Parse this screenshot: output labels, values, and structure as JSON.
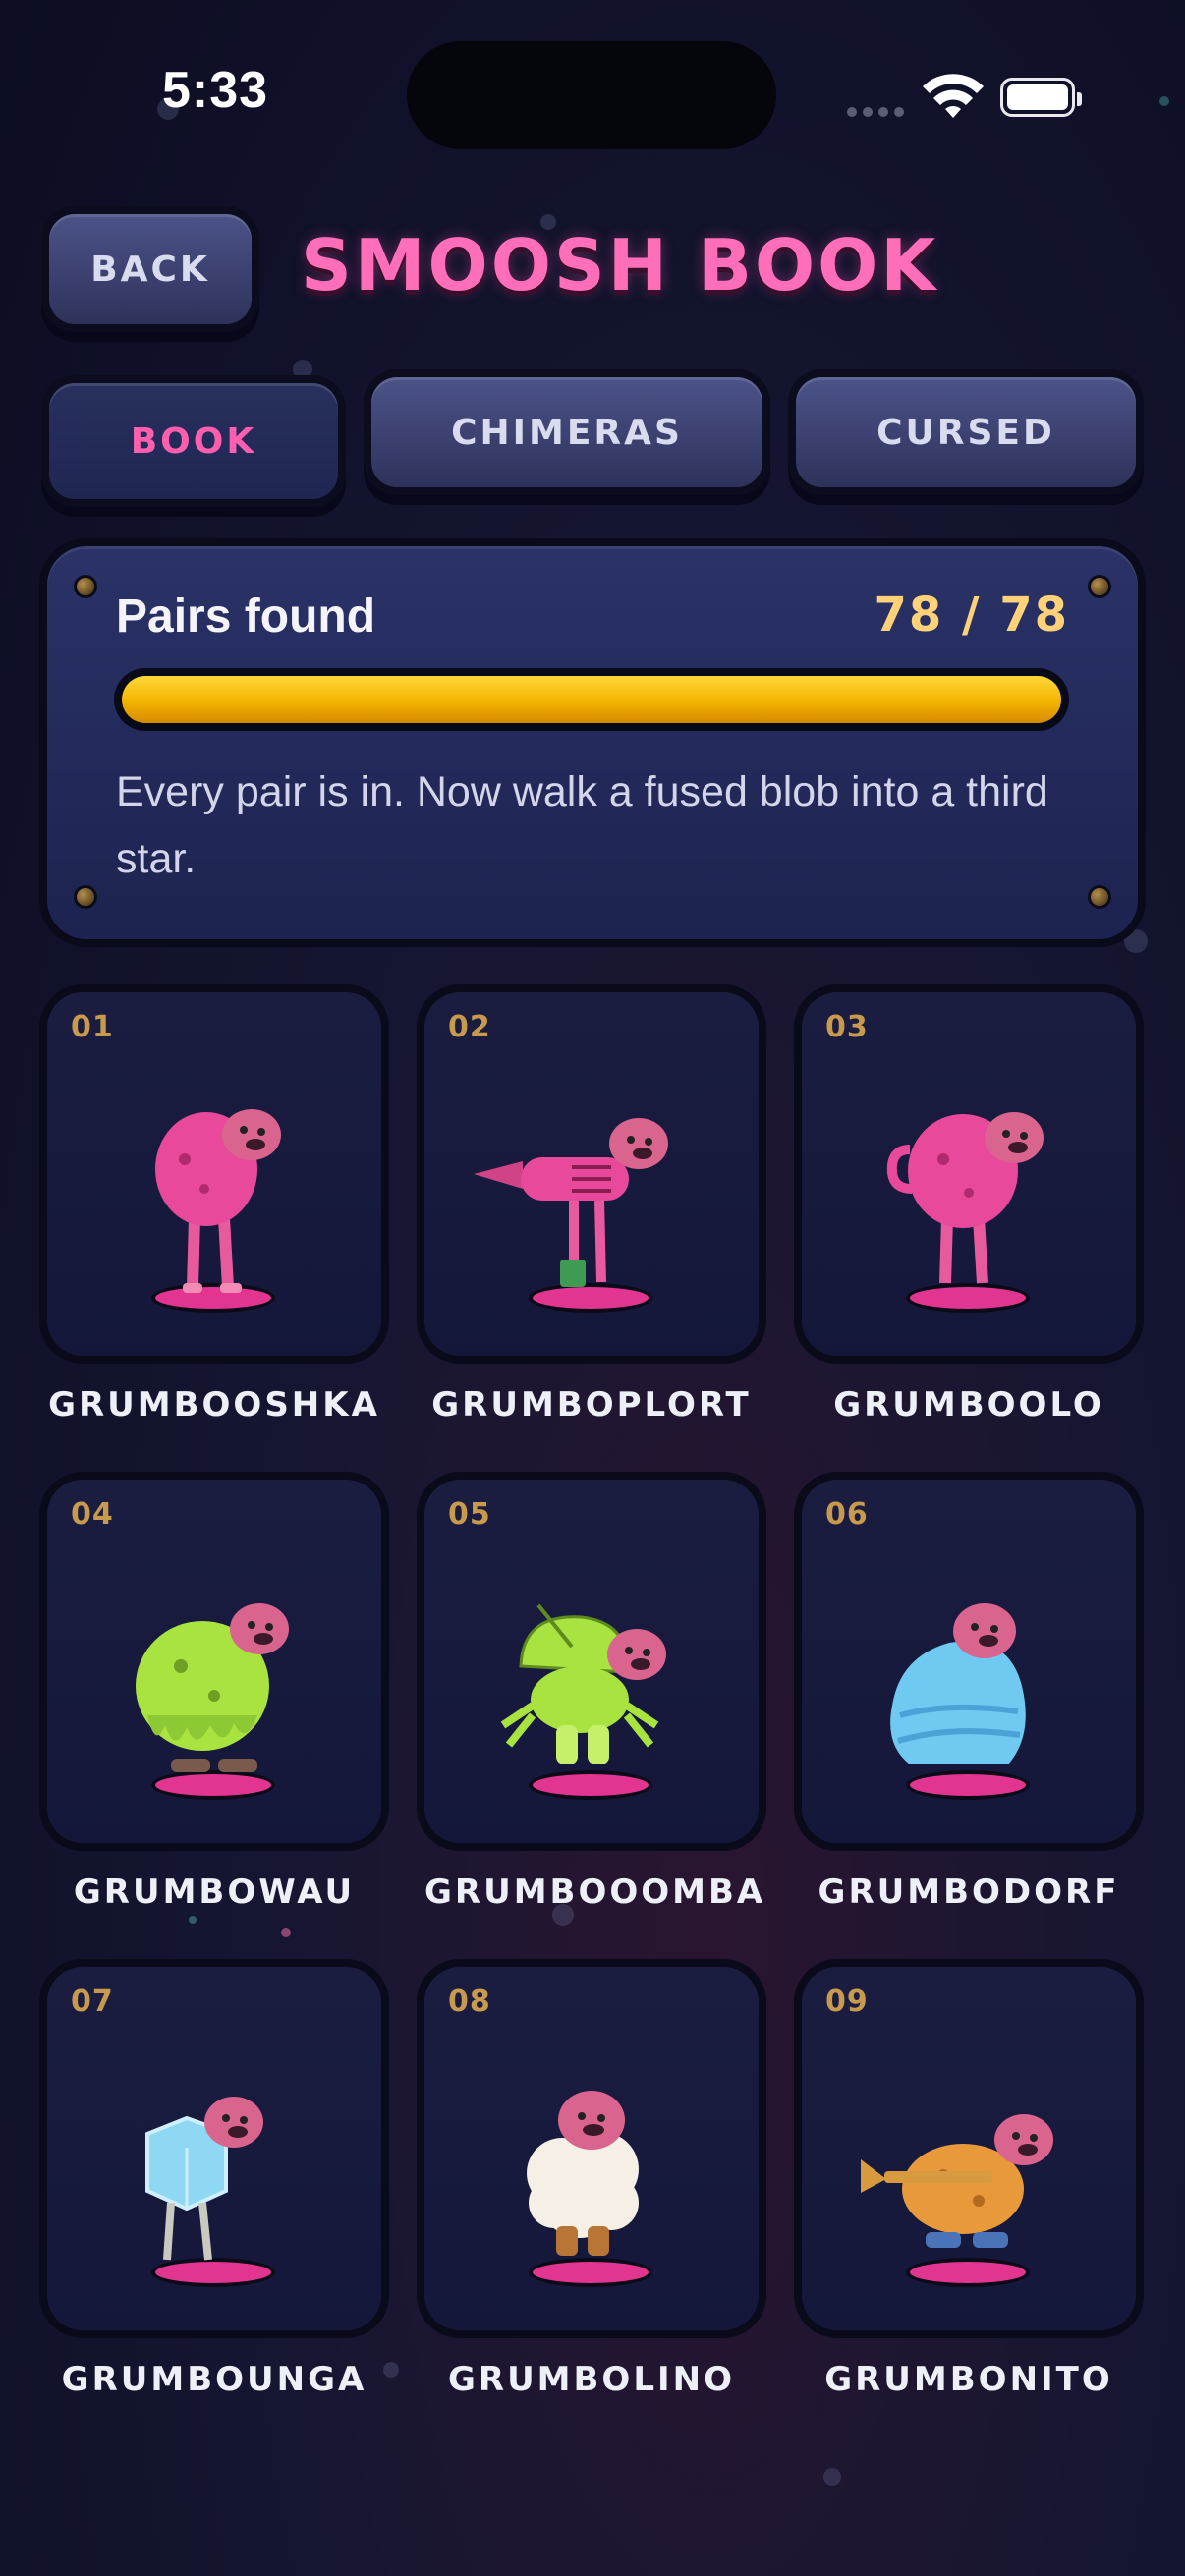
{
  "status_bar": {
    "time": "5:33"
  },
  "header": {
    "back_label": "BACK",
    "title": "SMOOSH BOOK"
  },
  "tabs": [
    {
      "label": "BOOK",
      "active": true
    },
    {
      "label": "CHIMERAS",
      "active": false
    },
    {
      "label": "CURSED",
      "active": false
    }
  ],
  "progress": {
    "label": "Pairs found",
    "count_text": "78 / 78",
    "found": 78,
    "total": 78,
    "fraction": 1.0,
    "description": "Every pair is in. Now walk a fused blob into a third star."
  },
  "colors": {
    "accent_pink": "#ff6fb9",
    "gold": "#ffd27a",
    "progress_fill": "#f4b400",
    "card_bg": "#1a1d40"
  },
  "cards": [
    {
      "num": "01",
      "name": "GRUMBOOSHKA",
      "icon": "pink-blob-creature-icon"
    },
    {
      "num": "02",
      "name": "GRUMBOPLORT",
      "icon": "hairdryer-creature-icon"
    },
    {
      "num": "03",
      "name": "GRUMBOOLO",
      "icon": "pink-kettle-creature-icon"
    },
    {
      "num": "04",
      "name": "GRUMBOWAU",
      "icon": "green-slime-creature-icon"
    },
    {
      "num": "05",
      "name": "GRUMBOOOMBA",
      "icon": "satellite-crab-creature-icon"
    },
    {
      "num": "06",
      "name": "GRUMBODORF",
      "icon": "blue-blob-creature-icon"
    },
    {
      "num": "07",
      "name": "GRUMBOUNGA",
      "icon": "ice-cube-creature-icon"
    },
    {
      "num": "08",
      "name": "GRUMBOLINO",
      "icon": "sheep-creature-icon"
    },
    {
      "num": "09",
      "name": "GRUMBONITO",
      "icon": "trumpet-creature-icon"
    }
  ]
}
